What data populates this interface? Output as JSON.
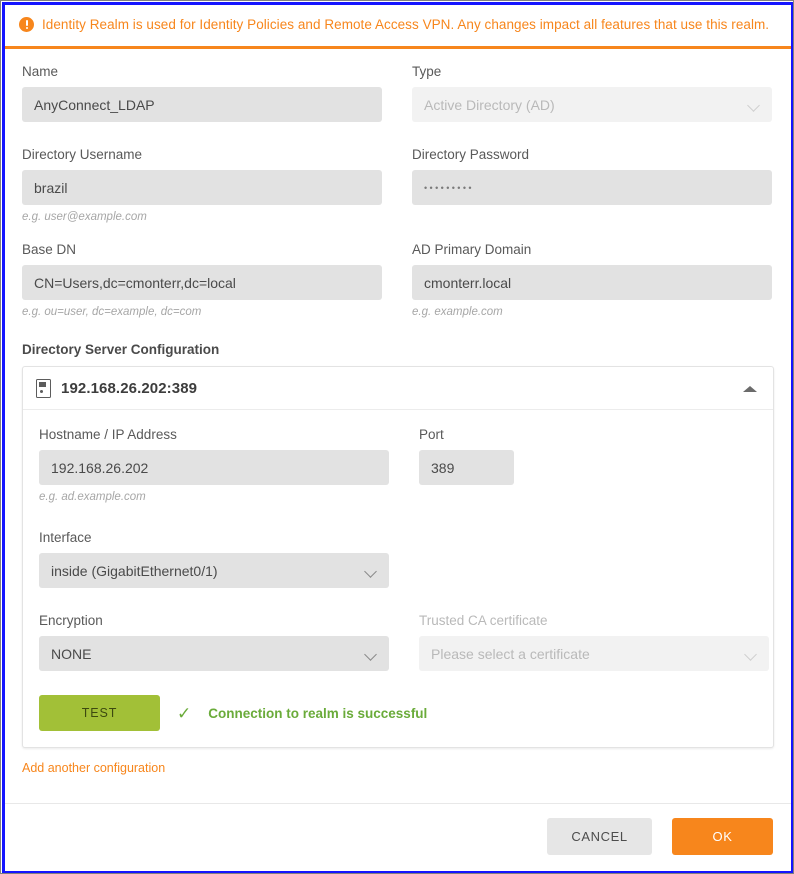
{
  "banner": {
    "icon": "warning-icon",
    "text": "Identity Realm is used for Identity Policies and Remote Access VPN. Any changes impact all features that use this realm.",
    "accent_color": "#f7861c"
  },
  "form": {
    "name": {
      "label": "Name",
      "value": "AnyConnect_LDAP"
    },
    "type": {
      "label": "Type",
      "value": "Active Directory (AD)",
      "disabled": true,
      "icon": "chevron-down-icon"
    },
    "directory_username": {
      "label": "Directory Username",
      "value": "brazil",
      "hint": "e.g. user@example.com"
    },
    "directory_password": {
      "label": "Directory Password",
      "value": "•••••••••"
    },
    "base_dn": {
      "label": "Base DN",
      "value": "CN=Users,dc=cmonterr,dc=local",
      "hint": "e.g. ou=user, dc=example, dc=com"
    },
    "ad_primary_domain": {
      "label": "AD Primary Domain",
      "value": "cmonterr.local",
      "hint": "e.g. example.com"
    }
  },
  "directory_server": {
    "section_title": "Directory Server Configuration",
    "card": {
      "icon": "server-icon",
      "title": "192.168.26.202:389",
      "collapse_icon": "caret-up-icon",
      "hostname": {
        "label": "Hostname / IP Address",
        "value": "192.168.26.202",
        "hint": "e.g. ad.example.com"
      },
      "port": {
        "label": "Port",
        "value": "389"
      },
      "interface": {
        "label": "Interface",
        "value": "inside (GigabitEthernet0/1)",
        "icon": "chevron-down-icon"
      },
      "encryption": {
        "label": "Encryption",
        "value": "NONE",
        "icon": "chevron-down-icon"
      },
      "trusted_ca": {
        "label": "Trusted CA certificate",
        "placeholder": "Please select a certificate",
        "disabled": true,
        "icon": "chevron-down-icon"
      },
      "test_button": "TEST",
      "test_result": {
        "icon": "check-icon",
        "text": "Connection to realm is successful",
        "color": "#6aab3a"
      }
    },
    "add_another": "Add another configuration"
  },
  "footer": {
    "cancel": "CANCEL",
    "ok": "OK",
    "ok_color": "#f7861c"
  }
}
